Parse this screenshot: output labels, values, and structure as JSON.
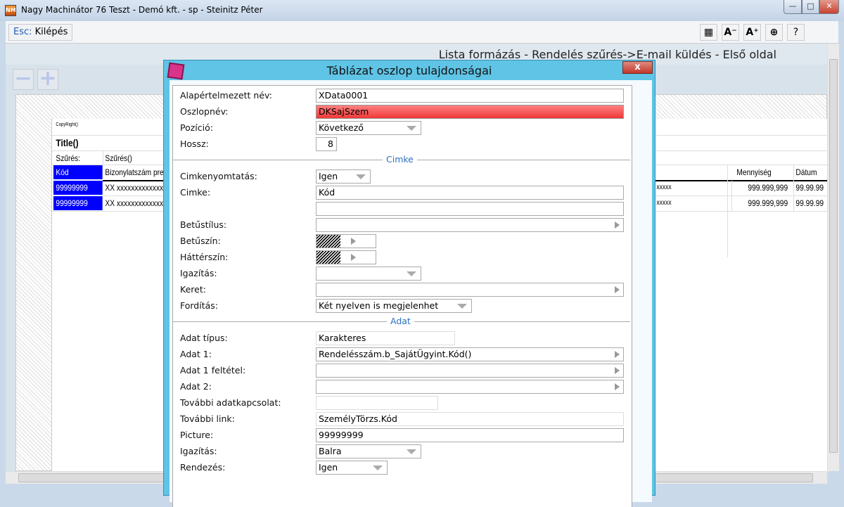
{
  "window": {
    "title": "Nagy Machinátor 76 Teszt - Demó kft. - sp - Steinitz Péter",
    "icon_text": "NM",
    "minimize": "—",
    "maximize": "□",
    "close": "✕"
  },
  "toolbar": {
    "esc_key": "Esc:",
    "esc_label": "Kilépés",
    "buttons": [
      "▦",
      "A⁻",
      "A⁺",
      "⊕",
      "?"
    ]
  },
  "page_heading": "Lista formázás - Rendelés szűrés->E-mail küldés - Első oldal",
  "zoom": {
    "minus": "−",
    "plus": "+"
  },
  "report": {
    "copyright": "CopyRight()",
    "title": "Title()",
    "filter_label": "Szűrés:",
    "filter_value": "Szűrés()",
    "headers": {
      "kod": "Kód",
      "bizonylat": "Bizonylatszám pref",
      "mennyiseg": "Mennyiség",
      "datum": "Dátum"
    },
    "rows": [
      {
        "kod": "99999999",
        "text": "XX xxxxxxxxxxxxxx",
        "tail": "xxxxx",
        "mennyiseg": "999.999,999",
        "datum": "99.99.99"
      },
      {
        "kod": "99999999",
        "text": "XX xxxxxxxxxxxxxx",
        "tail": "xxxxx",
        "mennyiseg": "999.999,999",
        "datum": "99.99.99"
      }
    ]
  },
  "dialog": {
    "title": "Táblázat oszlop tulajdonságai",
    "close": "x",
    "fields": {
      "default_name": {
        "label": "Alapértelmezett név:",
        "value": "XData0001"
      },
      "column_name": {
        "label": "Oszlopnév:",
        "value": "DKSajSzem"
      },
      "position": {
        "label": "Pozíció:",
        "value": "Következő"
      },
      "length": {
        "label": "Hossz:",
        "value": "8"
      },
      "section_label": "Cimke",
      "label_print": {
        "label": "Cimkenyomtatás:",
        "value": "Igen"
      },
      "label_text": {
        "label": "Cimke:",
        "value": "Kód",
        "value2": ""
      },
      "font_style": {
        "label": "Betűstílus:",
        "value": ""
      },
      "font_color": {
        "label": "Betűszín:"
      },
      "bg_color": {
        "label": "Háttérszín:"
      },
      "alignment": {
        "label": "Igazítás:",
        "value": ""
      },
      "border": {
        "label": "Keret:",
        "value": ""
      },
      "translation": {
        "label": "Fordítás:",
        "value": "Két nyelven is megjelenhet"
      },
      "section_data": "Adat",
      "data_type": {
        "label": "Adat típus:",
        "value": "Karakteres"
      },
      "data1": {
        "label": "Adat 1:",
        "value": "Rendelésszám.b_SajátÜgyint.Kód()"
      },
      "data1_cond": {
        "label": "Adat 1 feltétel:",
        "value": ""
      },
      "data2": {
        "label": "Adat 2:",
        "value": ""
      },
      "extra_relation": {
        "label": "További adatkapcsolat:",
        "value": ""
      },
      "extra_link": {
        "label": "További link:",
        "value": "SzemélyTörzs.Kód"
      },
      "picture": {
        "label": "Picture:",
        "value": "99999999"
      },
      "data_alignment": {
        "label": "Igazítás:",
        "value": "Balra"
      },
      "sorting": {
        "label": "Rendezés:",
        "value": "Igen"
      }
    }
  },
  "colors": {
    "accent": "#5fc4e6",
    "kod_column": "#0000ff",
    "error_field": "#f04040"
  }
}
